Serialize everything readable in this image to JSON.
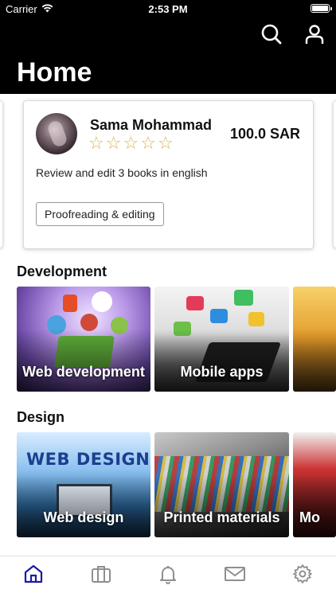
{
  "status_bar": {
    "carrier": "Carrier",
    "time": "2:53 PM"
  },
  "header": {
    "title": "Home",
    "actions": [
      "search-icon",
      "user-icon"
    ]
  },
  "featured_job": {
    "user_name": "Sama Mohammad",
    "rating": 0,
    "rating_max": 5,
    "price": "100.0 SAR",
    "description": "Review and edit 3 books in english",
    "tag": "Proofreading & editing"
  },
  "sections": [
    {
      "title": "Development",
      "items": [
        {
          "label": "Web development"
        },
        {
          "label": "Mobile apps"
        },
        {
          "label": ""
        }
      ]
    },
    {
      "title": "Design",
      "items": [
        {
          "label": "Web design"
        },
        {
          "label": "Printed materials"
        },
        {
          "label": "Mo"
        }
      ]
    }
  ],
  "tabbar": {
    "active_color": "#1a1aa6",
    "inactive_color": "#8e8e93",
    "tabs": [
      {
        "icon": "home-icon",
        "active": true
      },
      {
        "icon": "briefcase-icon",
        "active": false
      },
      {
        "icon": "bell-icon",
        "active": false
      },
      {
        "icon": "mail-icon",
        "active": false
      },
      {
        "icon": "gear-icon",
        "active": false
      }
    ]
  },
  "colors": {
    "header_bg": "#000000",
    "star": "#e0b24a"
  }
}
